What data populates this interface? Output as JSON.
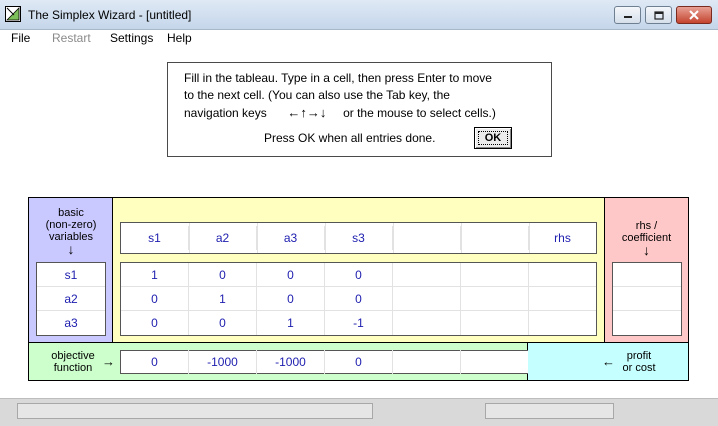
{
  "window": {
    "title": "The Simplex Wizard - [untitled]"
  },
  "menu": {
    "items": [
      {
        "label": "File",
        "enabled": true
      },
      {
        "label": "Restart",
        "enabled": false
      },
      {
        "label": "Settings",
        "enabled": true
      },
      {
        "label": "Help",
        "enabled": true
      }
    ]
  },
  "instructions": {
    "line1": "Fill in the tableau.  Type in a cell, then press Enter to move",
    "line2": "to the next cell.  (You can also use the Tab key, the",
    "line3_prefix": "navigation keys",
    "line3_arrows": "←↑→↓",
    "line3_suffix": "or the mouse to select cells.)",
    "press_ok": "Press OK when all entries done.",
    "ok_label": "OK"
  },
  "tableau": {
    "basic_label_1": "basic",
    "basic_label_2": "(non-zero)",
    "basic_label_3": "variables",
    "rhs_label_1": "rhs /",
    "rhs_label_2": "coefficient",
    "objective_label_1": "objective",
    "objective_label_2": "function",
    "profit_label_1": "profit",
    "profit_label_2": "or cost",
    "arrow_down": "↓",
    "arrow_right": "→",
    "arrow_left": "←",
    "column_headers": [
      "s1",
      "a2",
      "a3",
      "s3",
      "",
      "",
      "rhs"
    ],
    "basic_variables": [
      "s1",
      "a2",
      "a3"
    ],
    "rows": [
      [
        "1",
        "0",
        "0",
        "0",
        "",
        "",
        ""
      ],
      [
        "0",
        "1",
        "0",
        "0",
        "",
        "",
        ""
      ],
      [
        "0",
        "0",
        "1",
        "-1",
        "",
        "",
        ""
      ]
    ],
    "rhs_coefficients": [
      "",
      "",
      ""
    ],
    "objective_row": [
      "0",
      "-1000",
      "-1000",
      "0",
      "",
      "",
      ""
    ]
  },
  "colors": {
    "basic_panel": "#c9c8ff",
    "main_panel": "#ffffc0",
    "rhs_panel": "#ffc8c8",
    "objective_panel": "#ccffcc",
    "profit_panel": "#c6ffff",
    "cell_text": "#2020b0"
  }
}
